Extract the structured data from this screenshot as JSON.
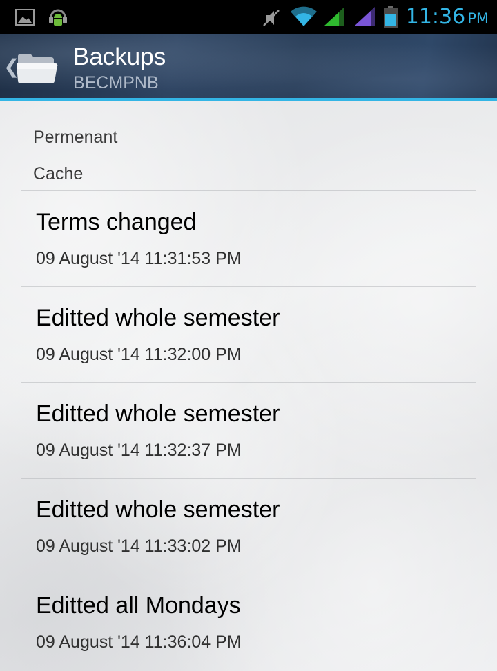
{
  "status_bar": {
    "time": "11:36",
    "ampm": "PM",
    "icons": [
      "image-icon",
      "android-headphones-icon",
      "muted-icon",
      "wifi-icon",
      "signal-icon-green",
      "signal-icon-purple",
      "battery-icon"
    ],
    "colors": {
      "clock": "#33b5e5",
      "signal_1": "#2fba2f",
      "signal_2": "#7a55d6",
      "battery": "#33b5e5"
    }
  },
  "action_bar": {
    "title": "Backups",
    "subtitle": "BECMPNB",
    "icons": [
      "chevron-left-icon",
      "folder-icon"
    ]
  },
  "categories": [
    {
      "label": "Permenant"
    },
    {
      "label": "Cache"
    }
  ],
  "backups": [
    {
      "title": "Terms changed",
      "timestamp": "09 August '14 11:31:53 PM"
    },
    {
      "title": "Editted whole semester",
      "timestamp": "09 August '14 11:32:00 PM"
    },
    {
      "title": "Editted whole semester",
      "timestamp": "09 August '14 11:32:37 PM"
    },
    {
      "title": "Editted whole semester",
      "timestamp": "09 August '14 11:33:02 PM"
    },
    {
      "title": "Editted all Mondays",
      "timestamp": "09 August '14 11:36:04 PM"
    }
  ],
  "theme": {
    "accent": "#33b5e5",
    "action_bar_bg": "#2a3f5c"
  }
}
